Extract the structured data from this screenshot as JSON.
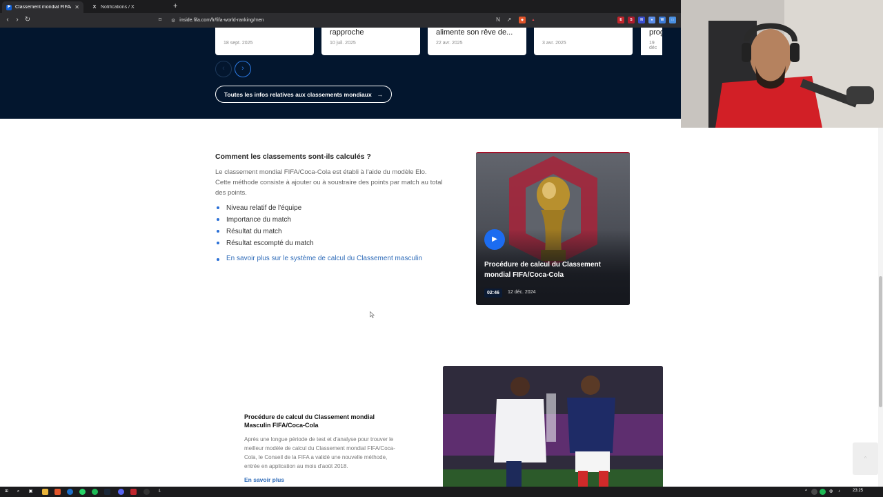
{
  "browser": {
    "tabs": [
      {
        "title": "Classement mondial FIFA/Coca-",
        "favicon": "F",
        "active": true
      },
      {
        "title": "Notifications / X",
        "favicon": "X",
        "active": false
      }
    ],
    "new_tab": "+",
    "url": "inside.fifa.com/fr/fifa-world-ranking/men"
  },
  "news_cards": [
    {
      "title": "",
      "date": "18 sept. 2025"
    },
    {
      "title": "rapproche",
      "date": "10 juil. 2025"
    },
    {
      "title": "alimente son rêve de...",
      "date": "22 avr. 2025"
    },
    {
      "title": "",
      "date": "3 avr. 2025"
    },
    {
      "title": "prog",
      "date": "19 déc"
    }
  ],
  "carousel": {
    "prev_icon": "‹",
    "next_icon": "›"
  },
  "all_news_button": {
    "label": "Toutes les infos relatives aux classements mondiaux",
    "icon": "→"
  },
  "calculation": {
    "heading": "Comment les classements sont-ils calculés ?",
    "paragraph": "Le classement mondial FIFA/Coca-Cola est établi à l'aide du modèle Elo. Cette méthode consiste à ajouter ou à soustraire des points par match au total des points.",
    "bullets": [
      "Niveau relatif de l'équipe",
      "Importance du match",
      "Résultat du match",
      "Résultat escompté du match"
    ],
    "link": "En savoir plus sur le système de calcul du Classement masculin"
  },
  "video": {
    "title": "Procédure de calcul du Classement mondial FIFA/Coca-Cola",
    "duration": "02:46",
    "date": "12 déc. 2024",
    "play_icon": "▶"
  },
  "procedure": {
    "heading": "Procédure de calcul du Classement mondial Masculin FIFA/Coca-Cola",
    "paragraph": "Après une longue période de test et d'analyse pour trouver le meilleur modèle de calcul du Classement mondial FIFA/Coca-Cola, le Conseil de la FIFA a validé une nouvelle méthode, entrée en application au mois d'août 2018.",
    "link": "En savoir plus"
  },
  "taskbar": {
    "time": "23:25"
  },
  "colors": {
    "dark_bg": "#03162e",
    "link_blue": "#2e6bb8",
    "accent_blue": "#1c6cf0",
    "video_border": "#a3122a"
  }
}
